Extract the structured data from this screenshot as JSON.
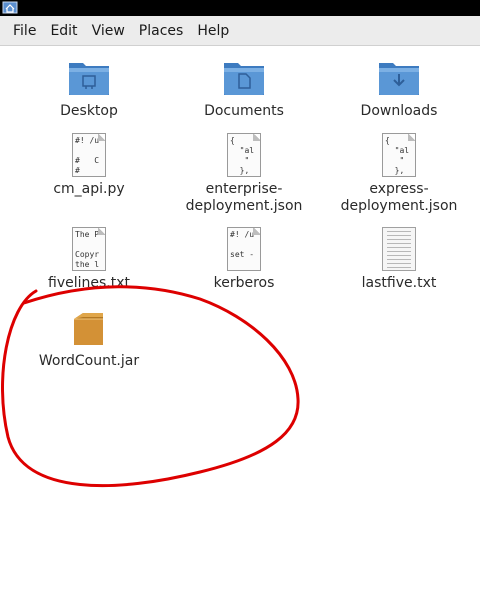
{
  "window": {
    "icon": "home-folder-icon"
  },
  "menubar": {
    "items": [
      "File",
      "Edit",
      "View",
      "Places",
      "Help"
    ]
  },
  "files": [
    {
      "name": "Desktop",
      "type": "folder",
      "icon": "desktop-folder-icon"
    },
    {
      "name": "Documents",
      "type": "folder",
      "icon": "documents-folder-icon"
    },
    {
      "name": "Downloads",
      "type": "folder",
      "icon": "downloads-folder-icon"
    },
    {
      "name_line1": "cm_api.py",
      "type": "script",
      "preview": "#! /u\n\n#   C\n#",
      "icon": "python-file-icon"
    },
    {
      "name_line1": "enterprise-",
      "name_line2": "deployment.json",
      "type": "json",
      "preview": "{\n  \"al\n   \"\n  },",
      "icon": "json-file-icon"
    },
    {
      "name_line1": "express-",
      "name_line2": "deployment.json",
      "type": "json",
      "preview": "{\n  \"al\n   \"\n  },",
      "icon": "json-file-icon"
    },
    {
      "name": "fivelines.txt",
      "type": "text",
      "preview": "The P\n\nCopyr\nthe l",
      "icon": "text-file-icon"
    },
    {
      "name": "kerberos",
      "type": "script",
      "preview": "#! /u\n\nset -",
      "icon": "shell-file-icon"
    },
    {
      "name": "lastfive.txt",
      "type": "text",
      "icon": "text-file-icon"
    },
    {
      "name": "WordCount.jar",
      "type": "archive",
      "icon": "jar-package-icon"
    }
  ],
  "annotation": {
    "color": "#dd0000",
    "shape": "freehand-circle"
  },
  "colors": {
    "folder": "#4a88c8",
    "jar": "#c98a2e",
    "titlebar": "#000000",
    "menubar": "#ececec"
  }
}
